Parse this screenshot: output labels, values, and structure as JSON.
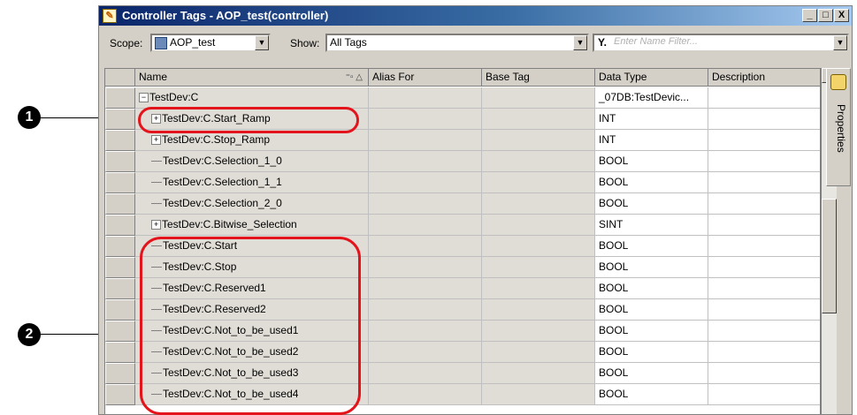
{
  "window": {
    "title": "Controller Tags - AOP_test(controller)",
    "buttons": {
      "minimize": "_",
      "maximize": "□",
      "close": "X"
    }
  },
  "toolbar": {
    "scope_label": "Scope:",
    "scope_value": "AOP_test",
    "show_label": "Show:",
    "show_value": "All Tags",
    "filter_placeholder": "Enter Name Filter..."
  },
  "columns": [
    "Name",
    "Alias For",
    "Base Tag",
    "Data Type",
    "Description"
  ],
  "rows": [
    {
      "name": "TestDev:C",
      "data_type": "_07DB:TestDevic..."
    },
    {
      "name": "TestDev:C.Start_Ramp",
      "data_type": "INT"
    },
    {
      "name": "TestDev:C.Stop_Ramp",
      "data_type": "INT"
    },
    {
      "name": "TestDev:C.Selection_1_0",
      "data_type": "BOOL"
    },
    {
      "name": "TestDev:C.Selection_1_1",
      "data_type": "BOOL"
    },
    {
      "name": "TestDev:C.Selection_2_0",
      "data_type": "BOOL"
    },
    {
      "name": "TestDev:C.Bitwise_Selection",
      "data_type": "SINT"
    },
    {
      "name": "TestDev:C.Start",
      "data_type": "BOOL"
    },
    {
      "name": "TestDev:C.Stop",
      "data_type": "BOOL"
    },
    {
      "name": "TestDev:C.Reserved1",
      "data_type": "BOOL"
    },
    {
      "name": "TestDev:C.Reserved2",
      "data_type": "BOOL"
    },
    {
      "name": "TestDev:C.Not_to_be_used1",
      "data_type": "BOOL"
    },
    {
      "name": "TestDev:C.Not_to_be_used2",
      "data_type": "BOOL"
    },
    {
      "name": "TestDev:C.Not_to_be_used3",
      "data_type": "BOOL"
    },
    {
      "name": "TestDev:C.Not_to_be_used4",
      "data_type": "BOOL"
    }
  ],
  "side_panel": {
    "label": "Properties"
  },
  "callouts": [
    "1",
    "2"
  ],
  "colors": {
    "highlight": "#e3141b",
    "titlebar": "#0a246a"
  }
}
